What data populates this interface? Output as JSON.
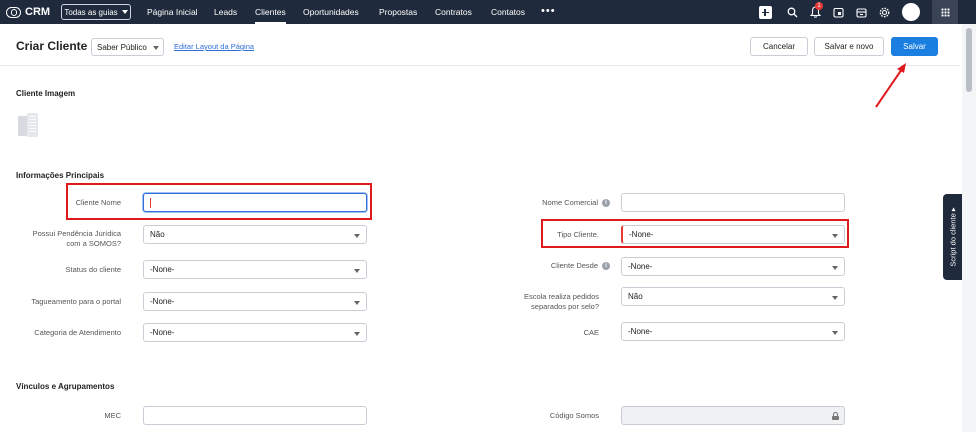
{
  "nav": {
    "logo": "CRM",
    "all_guides": "Todas as guias",
    "items": [
      "Página Inicial",
      "Leads",
      "Clientes",
      "Oportunidades",
      "Propostas",
      "Contratos",
      "Contatos"
    ],
    "active": "Clientes",
    "more": "•••",
    "notification_count": "1"
  },
  "header": {
    "title": "Criar Cliente",
    "layout_value": "Saber Público",
    "edit_layout_link": "Editar Layout da Página",
    "cancel_label": "Cancelar",
    "save_new_label": "Salvar e novo",
    "save_label": "Salvar"
  },
  "sections": {
    "image": "Cliente Imagem",
    "main": "Informações Principais",
    "links": "Vínculos e Agrupamentos"
  },
  "fields": {
    "cliente_nome": {
      "label": "Cliente Nome",
      "value": ""
    },
    "pendencia": {
      "label_line1": "Possui Pendência Jurídica",
      "label_line2": "com a SOMOS?",
      "value": "Não"
    },
    "status": {
      "label": "Status do cliente",
      "value": "-None-"
    },
    "tagueamento": {
      "label": "Tagueamento para o portal",
      "value": "-None-"
    },
    "categoria": {
      "label": "Categoria de Atendimento",
      "value": "-None-"
    },
    "nome_comercial": {
      "label": "Nome Comercial",
      "value": ""
    },
    "tipo_cliente": {
      "label": "Tipo Cliente.",
      "value": "-None-"
    },
    "cliente_desde": {
      "label": "Cliente Desde",
      "value": "-None-"
    },
    "escola": {
      "label_line1": "Escola realiza pedidos",
      "label_line2": "separados por selo?",
      "value": "Não"
    },
    "cae": {
      "label": "CAE",
      "value": "-None-"
    },
    "mec": {
      "label": "MEC",
      "value": ""
    },
    "codigo_somos": {
      "label": "Código Somos",
      "value": ""
    }
  },
  "script_tab": "Script do cliente  ▸",
  "colors": {
    "nav_bg": "#1f2a3c",
    "primary": "#1a7fe0",
    "annotation": "#e0191c",
    "link": "#2f6fd8"
  }
}
